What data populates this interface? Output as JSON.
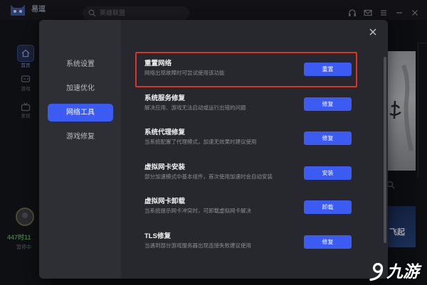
{
  "app": {
    "name": "易逗",
    "search": {
      "placeholder": "英雄联盟"
    },
    "window_controls": [
      "headset-icon",
      "mail-icon",
      "menu-icon",
      "minimize-icon",
      "close-icon"
    ],
    "sidebar": {
      "items": [
        {
          "label": "首页",
          "icon": "home-icon",
          "active": true
        },
        {
          "label": "游戏",
          "icon": "game-icon",
          "active": false
        },
        {
          "label": "发现",
          "icon": "tv-icon",
          "active": false
        }
      ]
    },
    "user": {
      "remaining": "447时11",
      "status": "暂停中"
    },
    "banner": {
      "text": "飞起"
    }
  },
  "dialog": {
    "close_icon": "close-icon",
    "nav": [
      {
        "label": "系统设置",
        "active": false
      },
      {
        "label": "加速优化",
        "active": false
      },
      {
        "label": "网络工具",
        "active": true
      },
      {
        "label": "游戏修复",
        "active": false
      }
    ],
    "tools": [
      {
        "title": "重置网络",
        "description": "网络出现故障时可尝试使用该功能",
        "button": "重置",
        "highlighted": true
      },
      {
        "title": "系统服务修复",
        "description": "解决应用、游戏无法启动或运行出错的问题",
        "button": "修复",
        "highlighted": false
      },
      {
        "title": "系统代理修复",
        "description": "当系统配置了代理模式，加速无效果时建议使用",
        "button": "修复",
        "highlighted": false
      },
      {
        "title": "虚拟网卡安装",
        "description": "部分加速模式中基本组件，首次使用加速时会自动安装",
        "button": "安装",
        "highlighted": false
      },
      {
        "title": "虚拟网卡卸载",
        "description": "当系统提示网卡冲突时，可卸载虚拟网卡解决",
        "button": "卸载",
        "highlighted": false
      },
      {
        "title": "TLS修复",
        "description": "当遇到部分游戏服务器出现连接失败建议使用",
        "button": "修复",
        "highlighted": false
      }
    ]
  },
  "watermark": {
    "text": "九游",
    "icon": "jiuyou-logo-icon"
  },
  "colors": {
    "accent": "#3b5bf2",
    "highlight": "#d8352c",
    "panel": "#27282d",
    "nav": "#2e2f35"
  }
}
